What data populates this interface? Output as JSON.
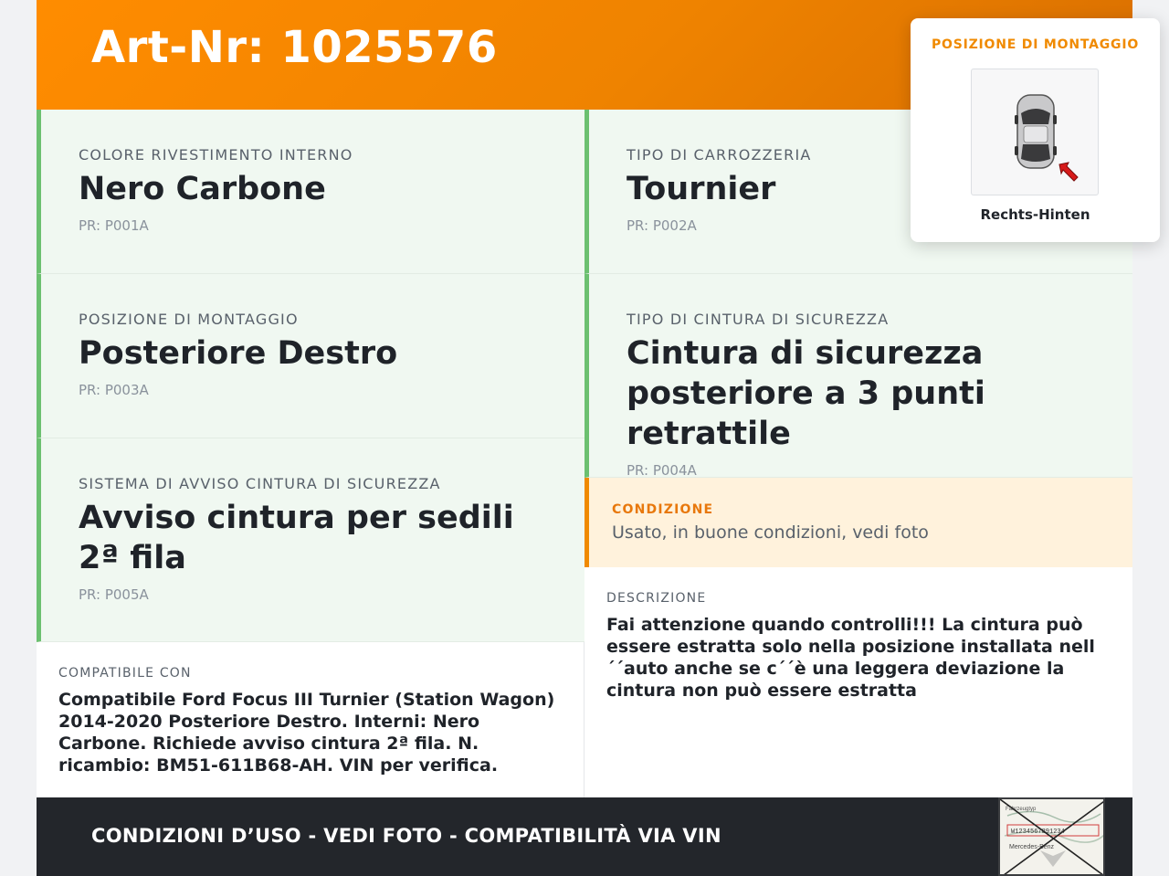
{
  "header": {
    "title": "Art-Nr: 1025576"
  },
  "specs": [
    {
      "label": "COLORE RIVESTIMENTO INTERNO",
      "value": "Nero Carbone",
      "pr": "PR: P001A"
    },
    {
      "label": "TIPO DI CARROZZERIA",
      "value": "Tournier",
      "pr": "PR: P002A"
    },
    {
      "label": "POSIZIONE DI MONTAGGIO",
      "value": "Posteriore Destro",
      "pr": "PR: P003A"
    },
    {
      "label": "TIPO DI CINTURA DI SICUREZZA",
      "value": "Cintura di sicurezza posteriore a 3 punti retrattile",
      "pr": "PR: P004A"
    },
    {
      "label": "SISTEMA DI AVVISO CINTURA DI SICUREZZA",
      "value": "Avviso cintura per sedili 2ª fila",
      "pr": "PR: P005A"
    }
  ],
  "condition": {
    "label": "CONDIZIONE",
    "text": "Usato, in buone condizioni, vedi foto"
  },
  "compat": {
    "label": "COMPATIBILE CON",
    "text": "Compatibile Ford Focus III Turnier (Station Wagon) 2014-2020 Posteriore Destro. Interni: Nero Carbone. Richiede avviso cintura 2ª fila. N. ricambio: BM51-611B68-AH. VIN per verifica."
  },
  "description": {
    "label": "DESCRIZIONE",
    "text": "Fai attenzione quando controlli!!! La cintura può essere estratta solo nella posizione installata nell´´auto anche se c´´è una leggera deviazione la cintura non può essere estratta"
  },
  "footer": {
    "text": "CONDIZIONI D’USO - VEDI FOTO - COMPATIBILITÀ VIA VIN"
  },
  "popup": {
    "title": "POSIZIONE DI MONTAGGIO",
    "caption": "Rechts-Hinten",
    "icon": "car-topview-icon"
  },
  "stamp": {
    "line1": "Fahrzeugtyp",
    "line2": "W1234567891234",
    "line3": "Mercedes-Benz"
  },
  "colors": {
    "accent": "#f08a00",
    "header": "#ff8c00",
    "green": "#6cc070",
    "footer": "#23262b"
  }
}
